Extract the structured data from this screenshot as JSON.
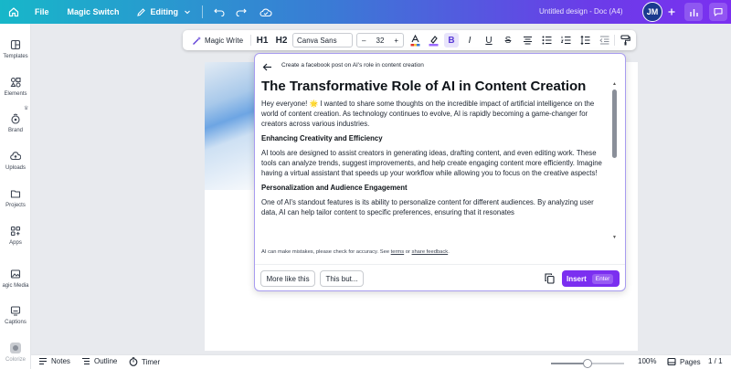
{
  "topbar": {
    "file_label": "File",
    "magic_switch_label": "Magic Switch",
    "editing_label": "Editing",
    "doc_title": "Untitled design - Doc (A4)",
    "avatar_initials": "JM"
  },
  "sidebar": {
    "items": [
      {
        "label": "Templates",
        "icon": "templates-icon"
      },
      {
        "label": "Elements",
        "icon": "elements-icon"
      },
      {
        "label": "Brand",
        "icon": "brand-icon"
      },
      {
        "label": "Uploads",
        "icon": "uploads-icon"
      },
      {
        "label": "Projects",
        "icon": "projects-icon"
      },
      {
        "label": "Apps",
        "icon": "apps-icon"
      },
      {
        "label": "agic Media",
        "icon": "magic-media-icon"
      },
      {
        "label": "Captions",
        "icon": "captions-icon"
      },
      {
        "label": "Colorize",
        "icon": "colorize-icon"
      }
    ]
  },
  "format_toolbar": {
    "magic_write_label": "Magic Write",
    "h1_label": "H1",
    "h2_label": "H2",
    "font_name": "Canva Sans",
    "font_size": "32",
    "minus": "–",
    "plus": "+",
    "bold": "B",
    "italic": "I",
    "underline": "U",
    "strike": "S"
  },
  "ai_panel": {
    "prompt": "Create a facebook post on AI's role in content creation",
    "heading": "The Transformative Role of AI in Content Creation",
    "intro": "Hey everyone! 🌟 I wanted to share some thoughts on the incredible impact of artificial intelligence on the world of content creation. As technology continues to evolve, AI is rapidly becoming a game-changer for creators across various industries.",
    "section1_title": "Enhancing Creativity and Efficiency",
    "section1_body": "AI tools are designed to assist creators in generating ideas, drafting content, and even editing work. These tools can analyze trends, suggest improvements, and help create engaging content more efficiently. Imagine having a virtual assistant that speeds up your workflow while allowing you to focus on the creative aspects!",
    "section2_title": "Personalization and Audience Engagement",
    "section2_body": "One of AI's standout features is its ability to personalize content for different audiences. By analyzing user data, AI can help tailor content to specific preferences, ensuring that it resonates",
    "disclaimer_prefix": "AI can make mistakes, please check for accuracy. See ",
    "terms_label": "terms",
    "disclaimer_or": " or ",
    "feedback_label": "share feedback",
    "disclaimer_suffix": ".",
    "more_like_this": "More like this",
    "this_but": "This but...",
    "insert_label": "Insert",
    "enter_key": "Enter"
  },
  "bottombar": {
    "notes_label": "Notes",
    "outline_label": "Outline",
    "timer_label": "Timer",
    "zoom": "100%",
    "zoom_fraction": 0.5,
    "pages_label": "Pages",
    "page_count": "1 / 1"
  },
  "colors": {
    "accent": "#7b2ff0",
    "gradient_start": "#17b7c9",
    "gradient_end": "#7b2ff0"
  }
}
